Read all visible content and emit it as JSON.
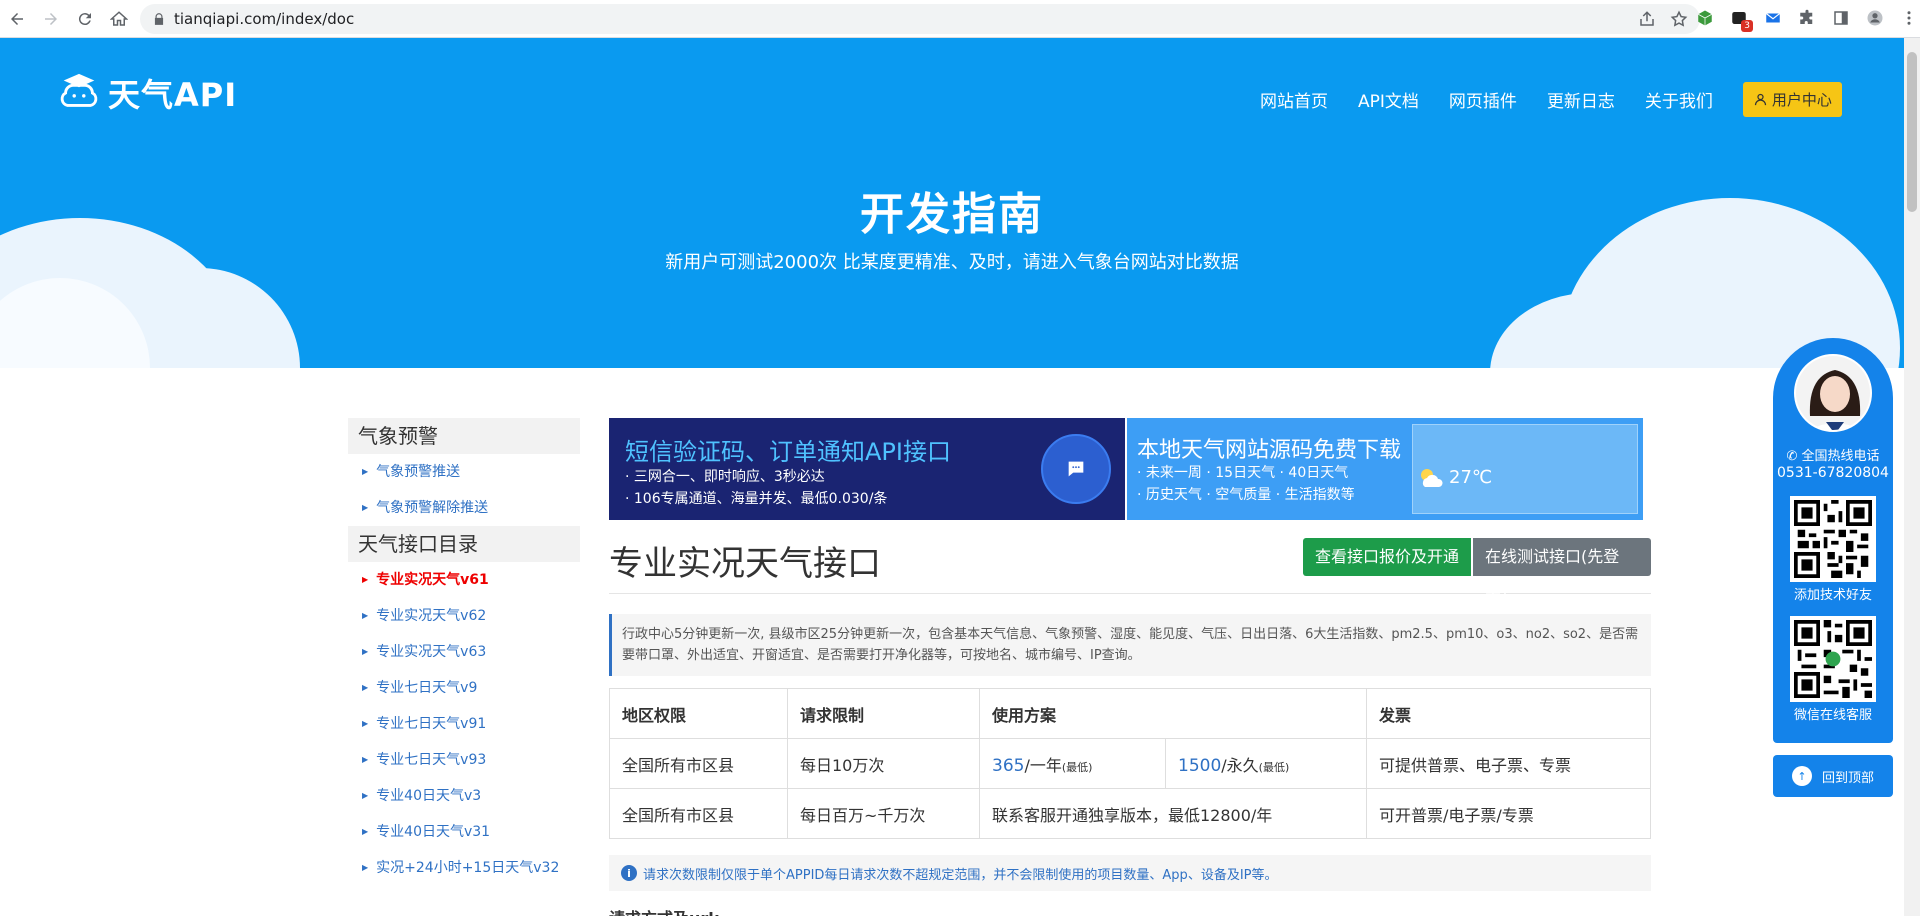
{
  "browser": {
    "url": "tianqiapi.com/index/doc",
    "ext_badge": "3"
  },
  "header": {
    "logo_text": "天气API",
    "nav": [
      "网站首页",
      "API文档",
      "网页插件",
      "更新日志",
      "关于我们"
    ],
    "user_center": "用户中心",
    "title": "开发指南",
    "subtitle": "新用户可测试2000次 比某度更精准、及时，请进入气象台网站对比数据"
  },
  "sidebar": {
    "sections": [
      {
        "heading": "气象预警",
        "items": [
          "气象预警推送",
          "气象预警解除推送"
        ]
      },
      {
        "heading": "天气接口目录",
        "items": [
          "专业实况天气v61",
          "专业实况天气v62",
          "专业实况天气v63",
          "专业七日天气v9",
          "专业七日天气v91",
          "专业七日天气v93",
          "专业40日天气v3",
          "专业40日天气v31",
          "实况+24小时+15日天气v32"
        ]
      }
    ],
    "active_item": "专业实况天气v61"
  },
  "ads": {
    "ad1": {
      "title": "短信验证码、订单通知API接口",
      "line1": "· 三网合一、即时响应、3秒必达",
      "line2": "· 106专属通道、海量并发、最低0.030/条"
    },
    "ad2": {
      "title": "本地天气网站源码免费下载",
      "line1": "· 未来一周  · 15日天气  · 40日天气",
      "line2": "· 历史天气  · 空气质量  · 生活指数等",
      "temp": "27℃"
    }
  },
  "main": {
    "api_title": "专业实况天气接口",
    "btn_price": "查看接口报价及开通",
    "btn_test": "在线测试接口(先登录)",
    "description": "行政中心5分钟更新一次, 县级市区25分钟更新一次，包含基本天气信息、气象预警、湿度、能见度、气压、日出日落、6大生活指数、pm2.5、pm10、o3、no2、so2、是否需要带口罩、外出适宜、开窗适宜、是否需要打开净化器等，可按地名、城市编号、IP查询。",
    "table": {
      "headers": [
        "地区权限",
        "请求限制",
        "使用方案",
        "发票"
      ],
      "row1": {
        "region": "全国所有市区县",
        "limit": "每日10万次",
        "plan1_num": "365",
        "plan1_unit": "/一年",
        "plan1_note": "(最低)",
        "plan2_num": "1500",
        "plan2_unit": "/永久",
        "plan2_note": "(最低)",
        "invoice": "可提供普票、电子票、专票"
      },
      "row2": {
        "region": "全国所有市区县",
        "limit": "每日百万~千万次",
        "plan": "联系客服开通独享版本，最低12800/年",
        "invoice": "可开普票/电子票/专票"
      }
    },
    "notice": "请求次数限制仅限于单个APPID每日请求次数不超规定范围，并不会限制使用的项目数量、App、设备及IP等。",
    "request_title": "请求方式及url:"
  },
  "float_panel": {
    "hotline_label": "全国热线电话",
    "phone": "0531-67820804",
    "qr1_label": "添加技术好友",
    "qr2_label": "微信在线客服",
    "back_top": "回到顶部"
  },
  "colors": {
    "brand_blue": "#0a9af0",
    "link_blue": "#2f71c4",
    "green": "#1d9c4a",
    "yellow": "#f6c515"
  }
}
